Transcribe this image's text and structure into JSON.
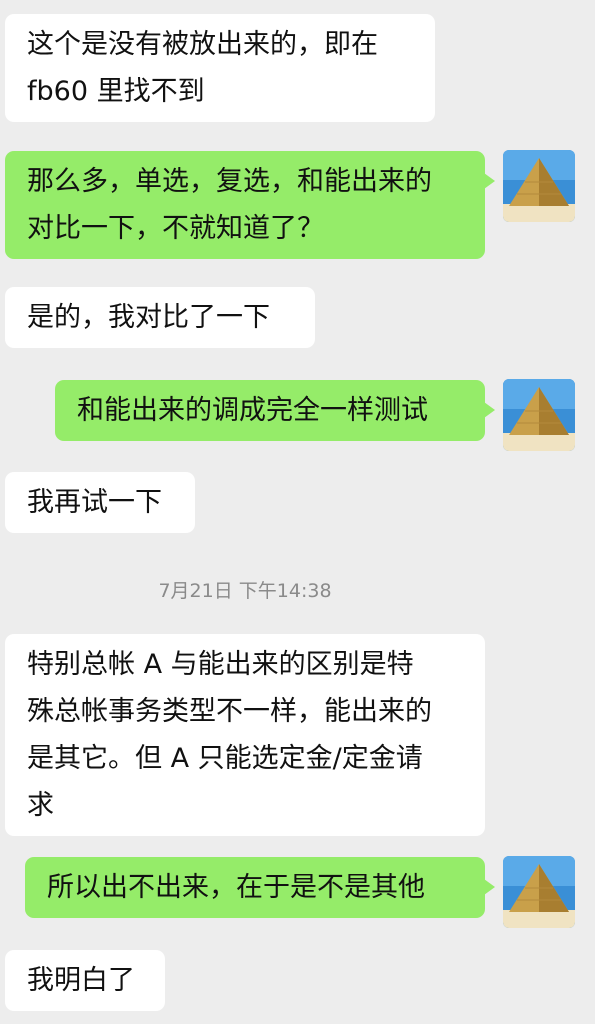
{
  "messages": [
    {
      "lines": [
        "这个是没有被放出来的，即在",
        "fb60 里找不到"
      ]
    },
    {
      "lines": [
        "那么多，单选，复选，和能出来的",
        "对比一下，不就知道了？"
      ]
    },
    {
      "lines": [
        "是的，我对比了一下"
      ]
    },
    {
      "lines": [
        "和能出来的调成完全一样测试"
      ]
    },
    {
      "lines": [
        "我再试一下"
      ]
    },
    {
      "lines": [
        "特别总帐 A 与能出来的区别是特",
        "殊总帐事务类型不一样，能出来的",
        "是其它。但 A 只能选定金/定金请",
        "求"
      ]
    },
    {
      "lines": [
        "所以出不出来，在于是不是其他"
      ]
    },
    {
      "lines": [
        "我明白了"
      ]
    }
  ],
  "timestamp": "7月21日 下午14:38",
  "colors": {
    "background": "#ededed",
    "incoming_bubble": "#ffffff",
    "outgoing_bubble": "#95ec69"
  },
  "icons": {
    "avatar": "pyramid-avatar-icon"
  }
}
